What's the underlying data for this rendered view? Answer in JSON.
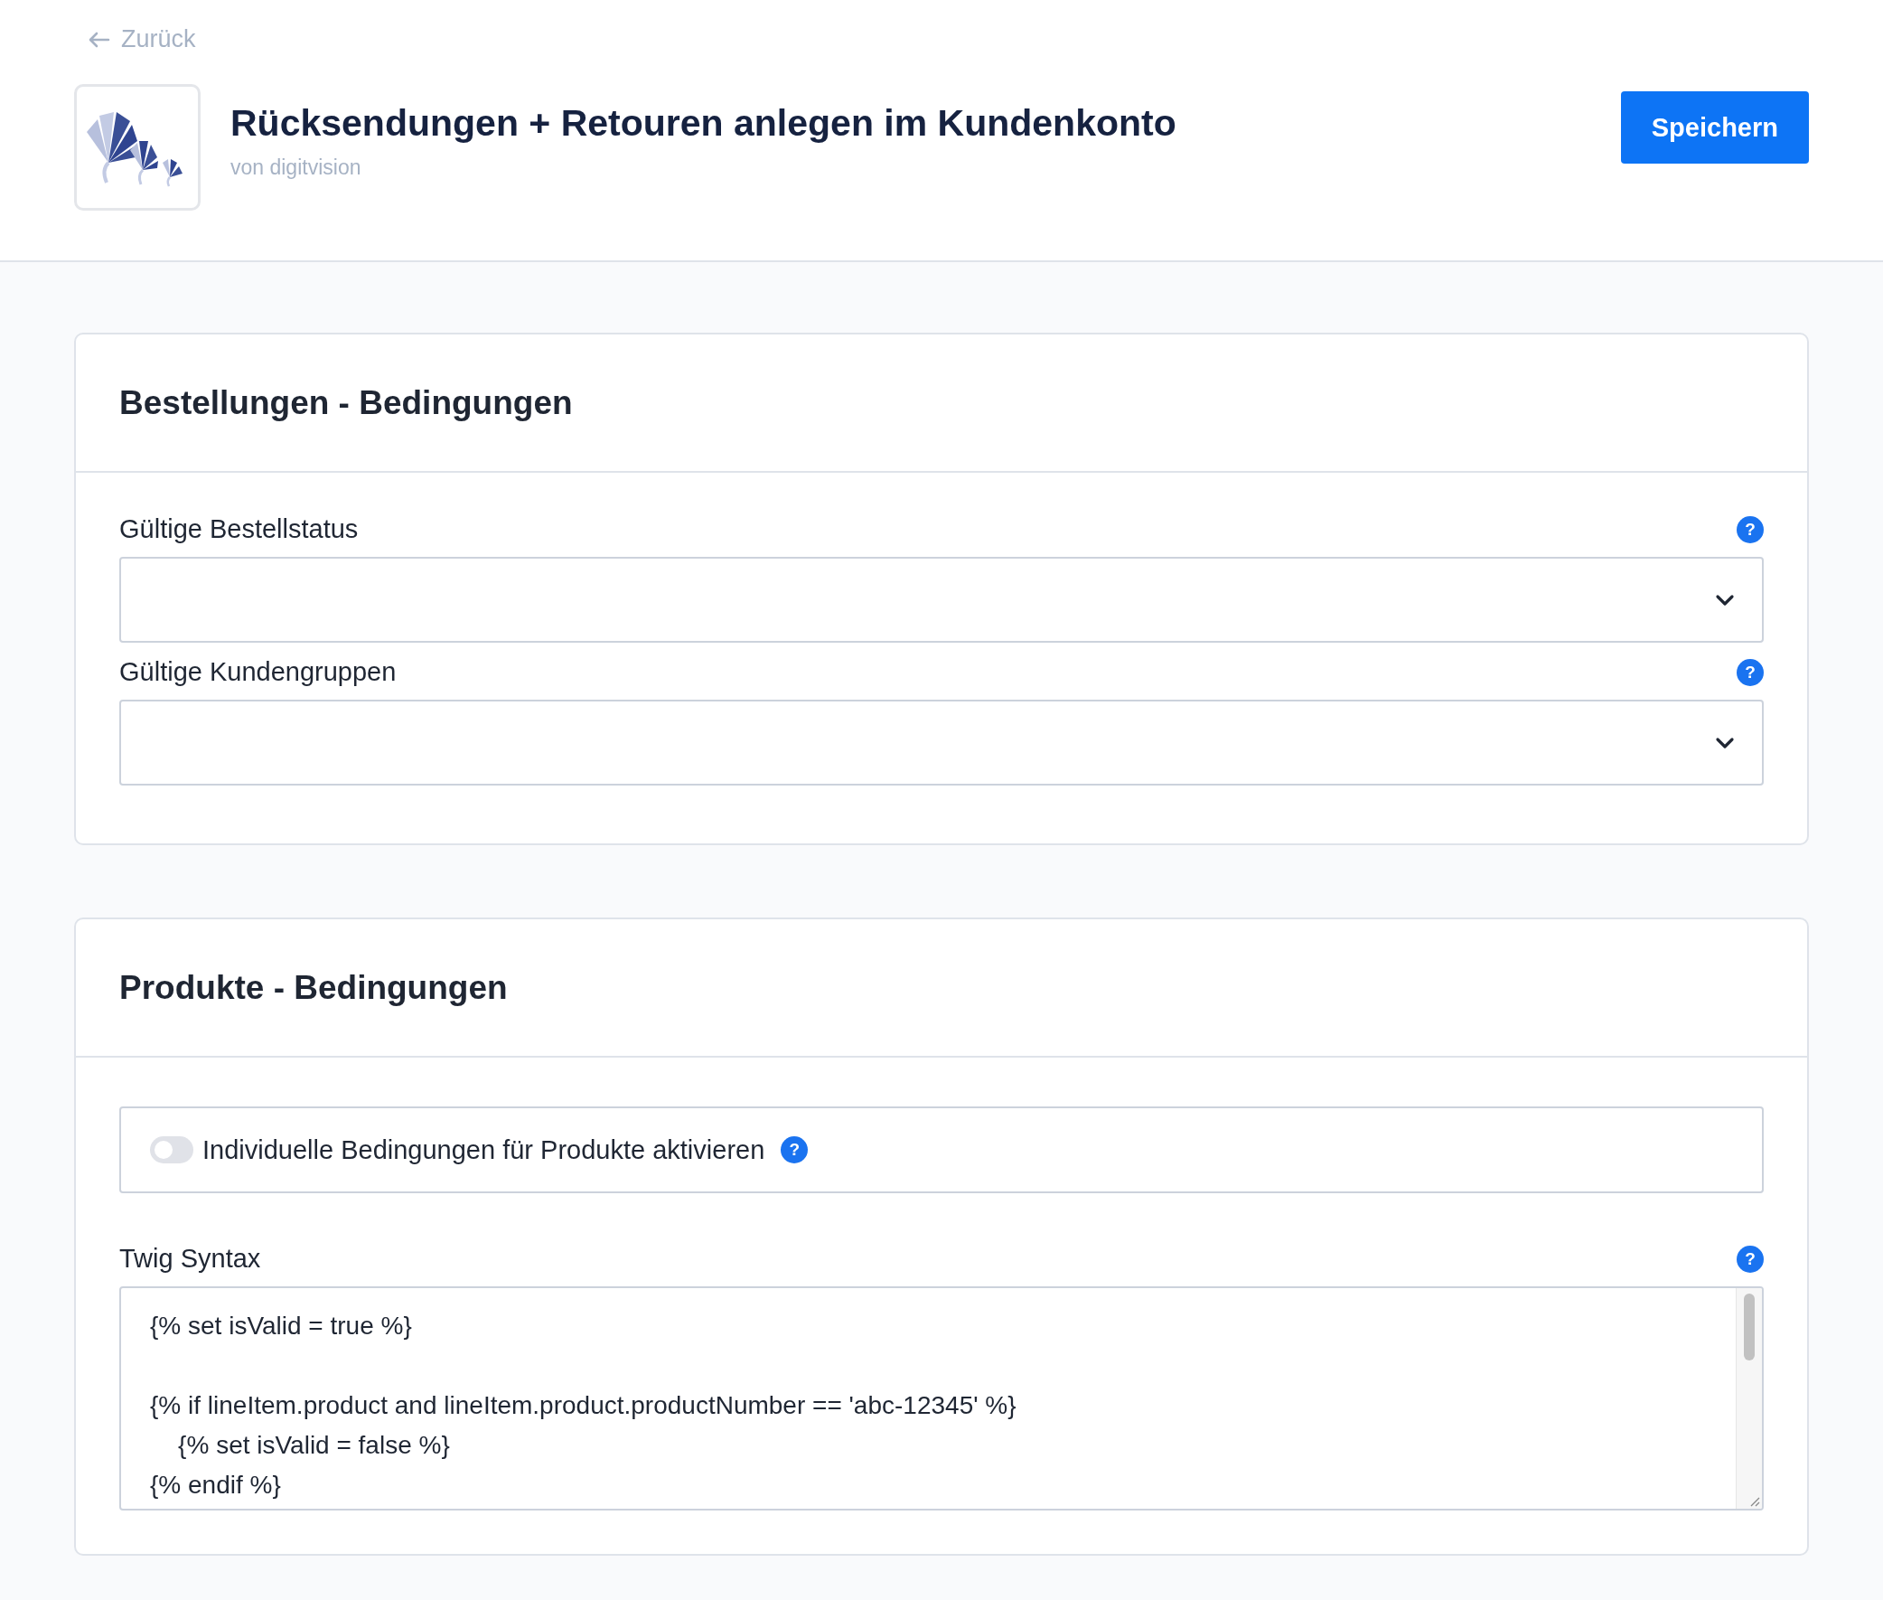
{
  "back_link": "Zurück",
  "header": {
    "title": "Rücksendungen + Retouren anlegen im Kundenkonto",
    "vendor": "von digitvision",
    "save_button": "Speichern"
  },
  "sections": [
    {
      "title": "Bestellungen - Bedingungen",
      "fields": [
        {
          "kind": "select",
          "label": "Gültige Bestellstatus",
          "help": "?"
        },
        {
          "kind": "select",
          "label": "Gültige Kundengruppen",
          "help": "?"
        }
      ]
    },
    {
      "title": "Produkte - Bedingungen",
      "fields": [
        {
          "kind": "toggle",
          "label": "Individuelle Bedingungen für Produkte aktivieren",
          "help": "?",
          "on": false
        },
        {
          "kind": "code",
          "label": "Twig Syntax",
          "help": "?",
          "value": "{% set isValid = true %}\n\n{% if lineItem.product and lineItem.product.productNumber == 'abc-12345' %}\n    {% set isValid = false %}\n{% endif %}"
        }
      ]
    }
  ]
}
